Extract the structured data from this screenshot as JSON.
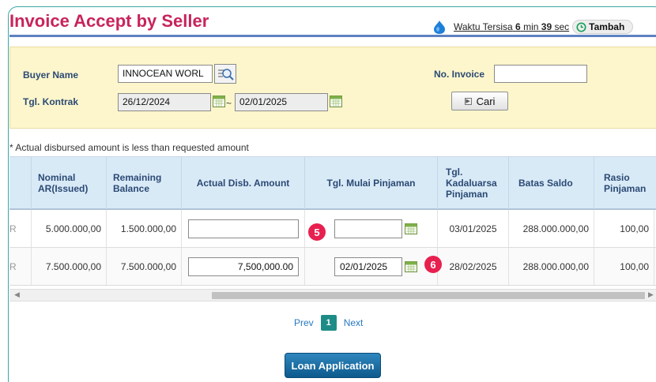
{
  "page": {
    "title": "Invoice Accept by Seller"
  },
  "timer": {
    "prefix": "Waktu Tersisa",
    "minutes": "6",
    "min_label": "min",
    "seconds": "39",
    "sec_label": "sec",
    "extend_label": "Tambah"
  },
  "search": {
    "buyer_label": "Buyer Name",
    "buyer_value": "INNOCEAN WORL",
    "contract_label": "Tgl. Kontrak",
    "contract_from": "26/12/2024",
    "separator": "~",
    "contract_to": "02/01/2025",
    "invoice_label": "No. Invoice",
    "invoice_value": "",
    "search_button": "Cari"
  },
  "note": "* Actual disbursed amount is less than requested amount",
  "table": {
    "headers": {
      "nominal": "Nominal AR(Issued)",
      "remaining": "Remaining Balance",
      "actual": "Actual Disb. Amount",
      "start": "Tgl. Mulai Pinjaman",
      "expiry": "Tgl. Kadaluarsa Pinjaman",
      "limit": "Batas Saldo",
      "ratio": "Rasio Pinjaman"
    },
    "rows": [
      {
        "lead": "R",
        "nominal": "5.000.000,00",
        "remaining": "1.500.000,00",
        "actual": "",
        "start": "",
        "expiry": "03/01/2025",
        "limit": "288.000.000,00",
        "ratio": "100,00"
      },
      {
        "lead": "R",
        "nominal": "7.500.000,00",
        "remaining": "7.500.000,00",
        "actual": "7,500,000.00",
        "start": "02/01/2025",
        "expiry": "28/02/2025",
        "limit": "288.000.000,00",
        "ratio": "100,00"
      }
    ]
  },
  "callouts": {
    "five": "5",
    "six": "6"
  },
  "pagination": {
    "prev": "Prev",
    "current": "1",
    "next": "Next"
  },
  "actions": {
    "loan_application": "Loan Application"
  },
  "colors": {
    "title": "#c8245c",
    "panel": "#fdf6cc",
    "header": "#d9eaf7",
    "callout": "#e8204f",
    "primary_button": "#0d5a8d"
  }
}
